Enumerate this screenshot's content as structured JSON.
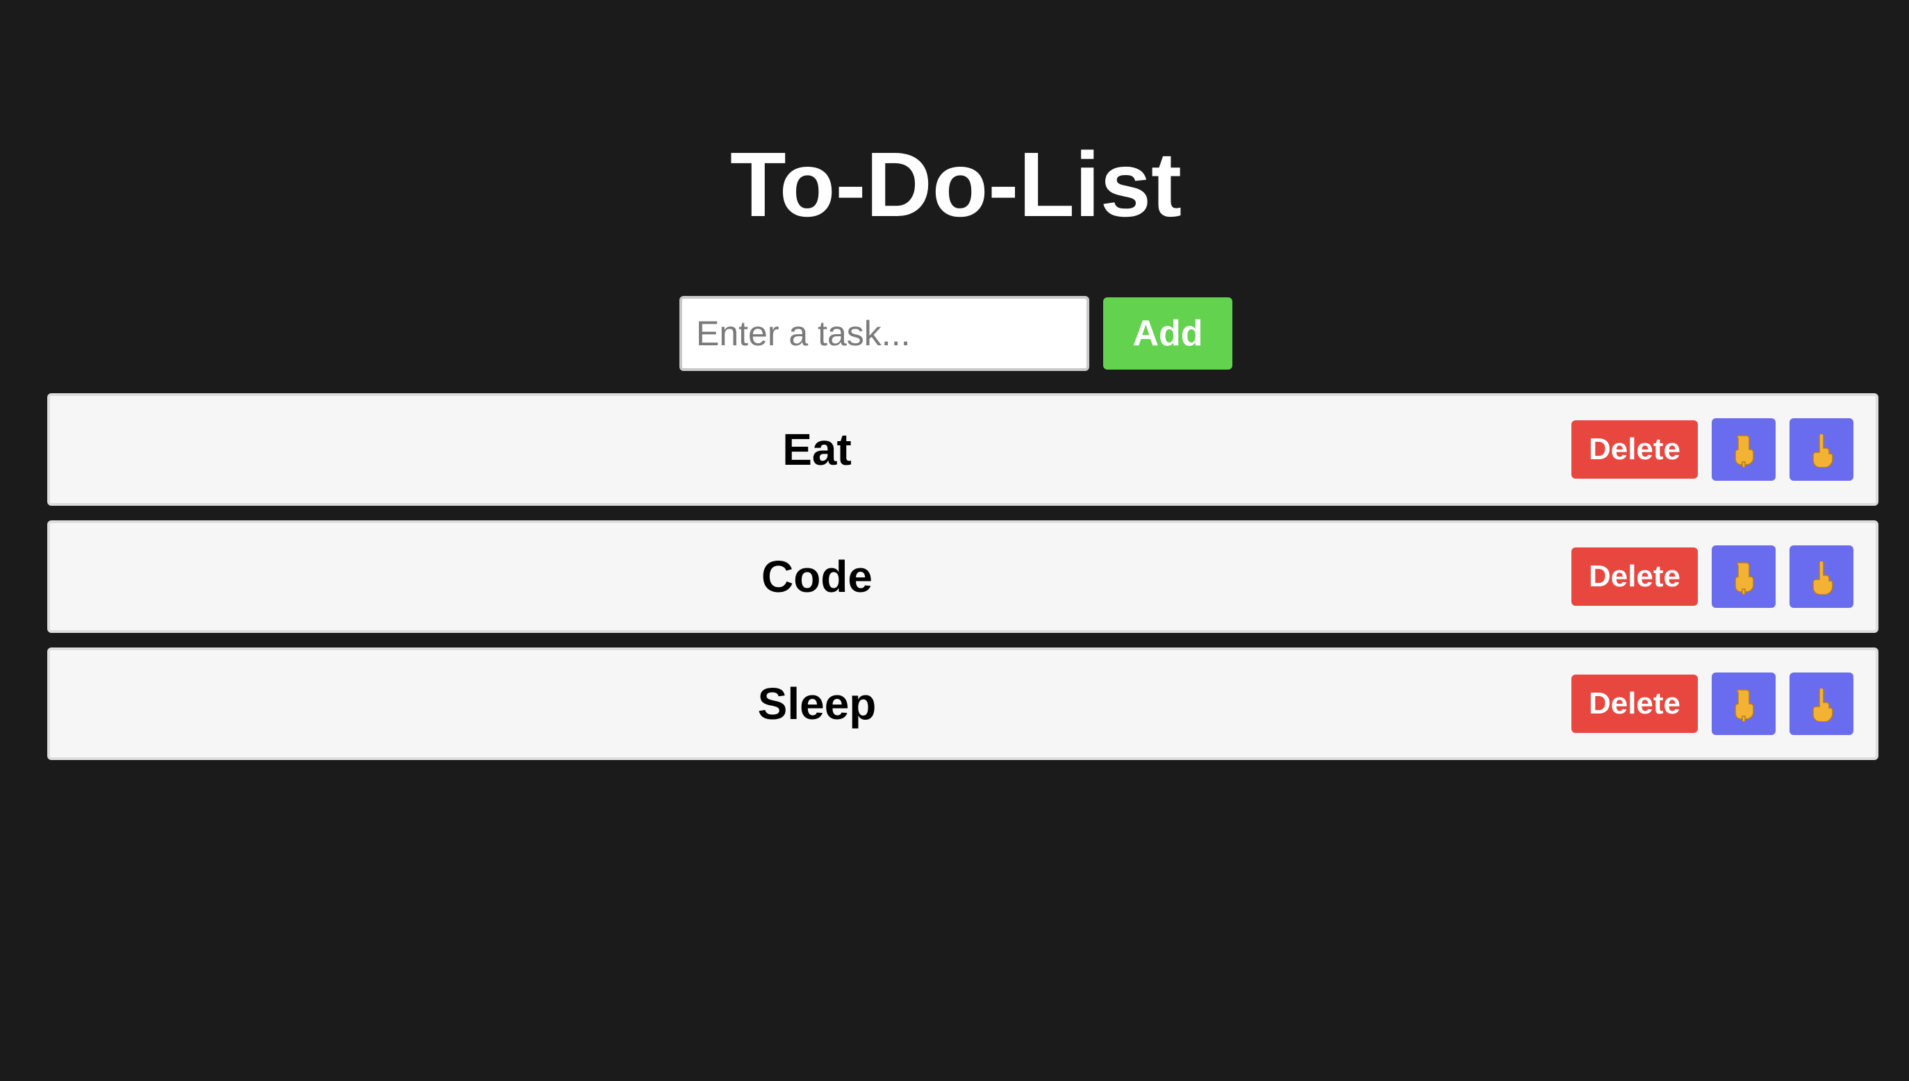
{
  "app": {
    "title": "To-Do-List"
  },
  "input": {
    "placeholder": "Enter a task...",
    "value": "",
    "add_label": "Add"
  },
  "tasks": [
    {
      "text": "Eat",
      "delete_label": "Delete",
      "down_icon": "hand-pointing-down-icon",
      "up_icon": "hand-pointing-up-icon"
    },
    {
      "text": "Code",
      "delete_label": "Delete",
      "down_icon": "hand-pointing-down-icon",
      "up_icon": "hand-pointing-up-icon"
    },
    {
      "text": "Sleep",
      "delete_label": "Delete",
      "down_icon": "hand-pointing-down-icon",
      "up_icon": "hand-pointing-up-icon"
    }
  ],
  "colors": {
    "background": "#1b1b1b",
    "add_button": "#63d24f",
    "delete_button": "#e8473f",
    "move_button": "#6a6cef",
    "task_background": "#f6f6f6"
  }
}
